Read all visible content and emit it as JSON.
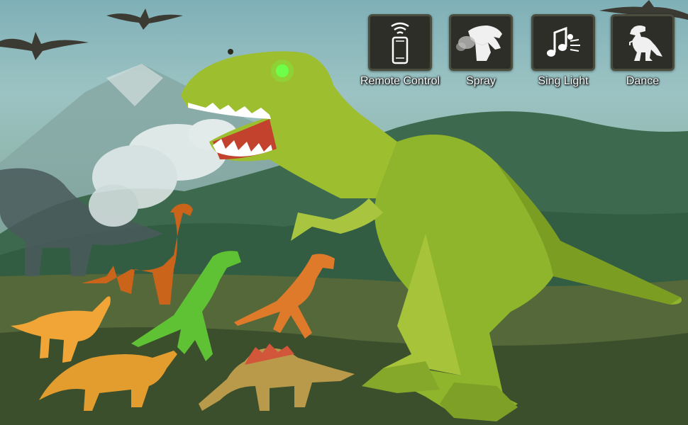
{
  "features": [
    {
      "label": "Remote Control",
      "icon": "remote-phone-icon"
    },
    {
      "label": "Spray",
      "icon": "spray-dino-head-icon"
    },
    {
      "label": "Sing Light",
      "icon": "music-light-icon"
    },
    {
      "label": "Dance",
      "icon": "dancing-trex-icon"
    }
  ],
  "colors": {
    "tile_bg": "#2c2e27",
    "label_text": "#ffffff",
    "trex_green": "#8fb52c",
    "eye_glow": "#6dff4a"
  }
}
